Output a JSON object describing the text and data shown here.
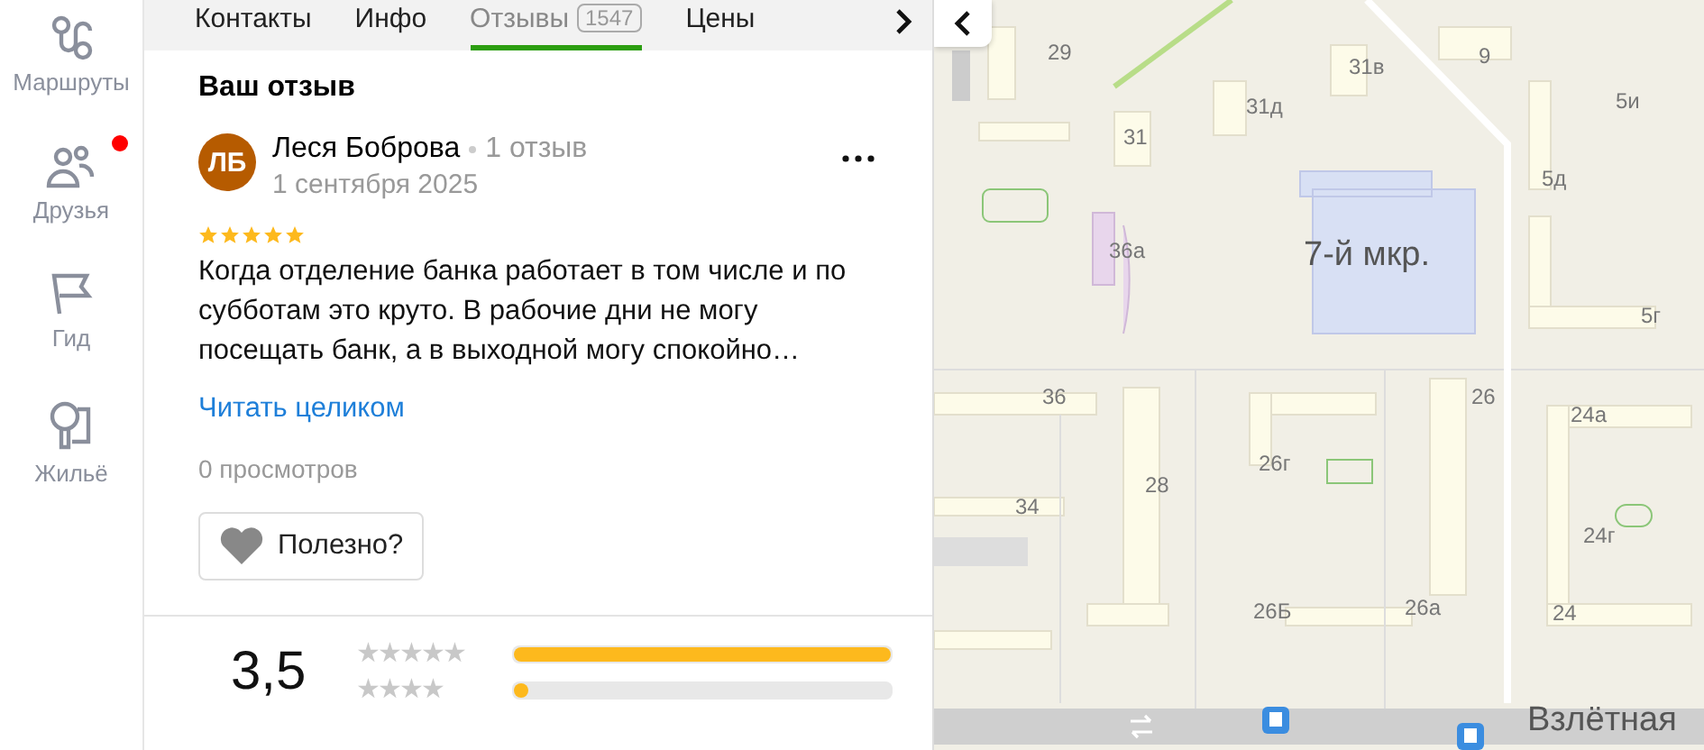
{
  "sidebar": {
    "items": [
      {
        "label": "Маршруты",
        "kind": "routes",
        "badge": false
      },
      {
        "label": "Друзья",
        "kind": "friends",
        "badge": true
      },
      {
        "label": "Гид",
        "kind": "guide",
        "badge": false
      },
      {
        "label": "Жильё",
        "kind": "housing",
        "badge": false
      }
    ]
  },
  "tabs": [
    {
      "label": "Контакты",
      "selected": false
    },
    {
      "label": "Инфо",
      "selected": false
    },
    {
      "label": "Отзывы",
      "count": "1547",
      "selected": true
    },
    {
      "label": "Цены",
      "selected": false
    }
  ],
  "my_review": {
    "heading": "Ваш отзыв",
    "avatar": "ЛБ",
    "author": "Леся Боброва",
    "author_reviews": "1 отзыв",
    "date": "1 сентября 2025",
    "stars": 5,
    "text": "Когда отделение банка работает в том числе и по субботам это круто. В рабочие дни не могу посещать банк, а в выходной могу спокойно…",
    "read_more": "Читать целиком",
    "views": "0 просмотров",
    "useful": "Полезно?"
  },
  "rating": {
    "value": "3,5",
    "rows": [
      {
        "label": "★★★★★",
        "level": 1.0
      },
      {
        "label": "★★★★",
        "level": 0.04
      }
    ]
  },
  "map": {
    "labels": [
      "29",
      "31в",
      "9",
      "31д",
      "31",
      "5и",
      "5д",
      "36а",
      "7-й мкр.",
      "5г",
      "36",
      "26",
      "24а",
      "26г",
      "28",
      "34",
      "24г",
      "26Б",
      "26а",
      "24",
      "Взлётная"
    ]
  }
}
